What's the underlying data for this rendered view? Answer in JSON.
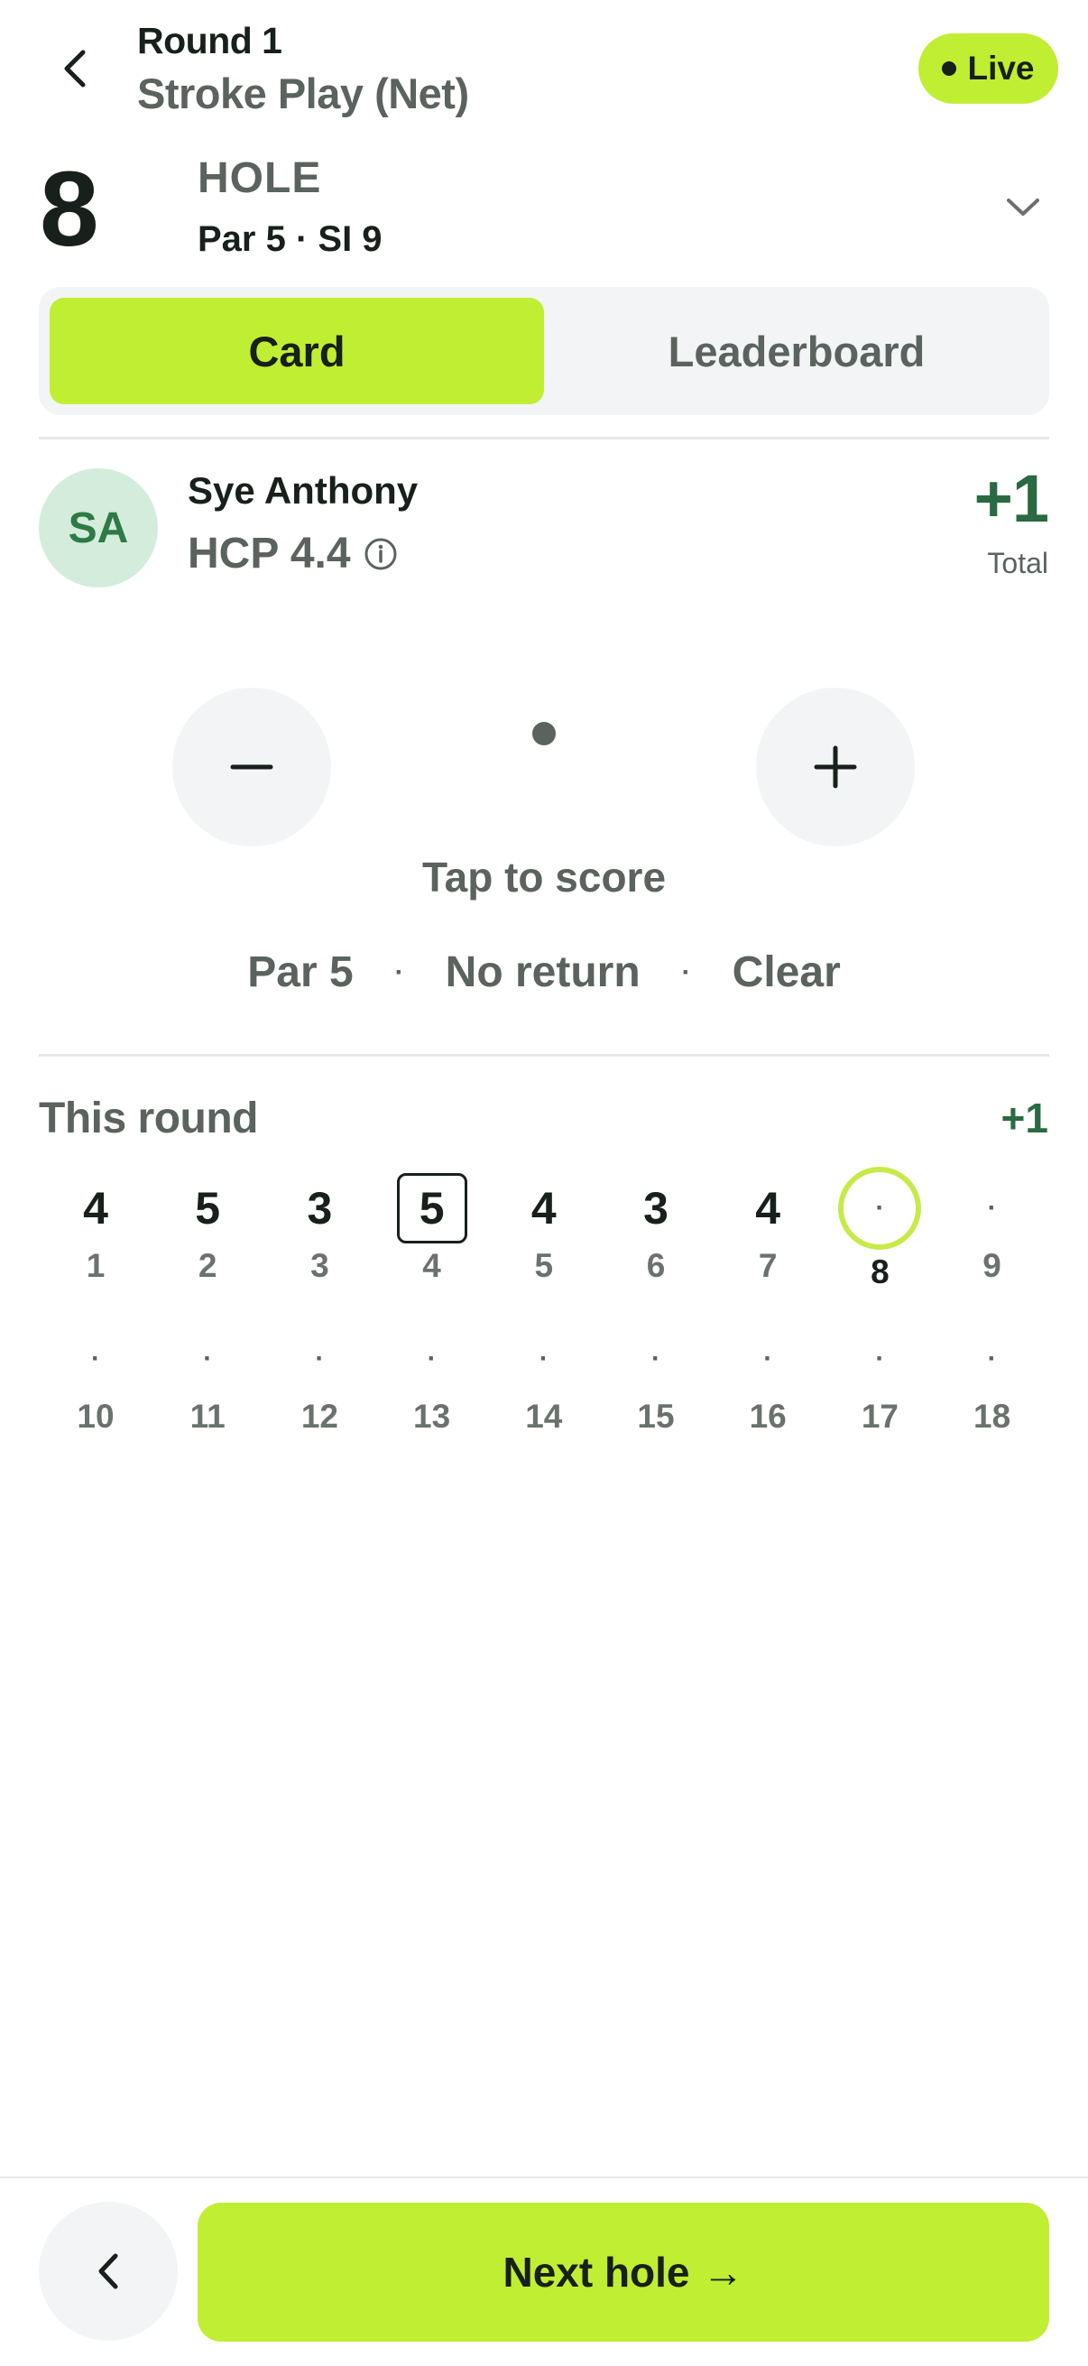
{
  "header": {
    "round_title": "Round 1",
    "format": "Stroke Play (Net)",
    "live_label": "Live"
  },
  "hole": {
    "number": "8",
    "label": "HOLE",
    "meta": "Par 5 · SI 9"
  },
  "tabs": [
    {
      "label": "Card",
      "selected": true
    },
    {
      "label": "Leaderboard",
      "selected": false
    }
  ],
  "player": {
    "initials": "SA",
    "name": "Sye Anthony",
    "hcp": "HCP 4.4",
    "total_score": "+1",
    "total_label": "Total"
  },
  "stepper": {
    "minus": "−",
    "plus": "+",
    "prompt": "Tap to score"
  },
  "quick_actions": {
    "par": "Par 5",
    "no_return": "No return",
    "clear": "Clear",
    "separator": "·"
  },
  "this_round": {
    "heading": "This round",
    "total": "+1",
    "empty_symbol": "·",
    "holes": [
      {
        "hole": "1",
        "score": "4",
        "state": "played"
      },
      {
        "hole": "2",
        "score": "5",
        "state": "played"
      },
      {
        "hole": "3",
        "score": "3",
        "state": "played"
      },
      {
        "hole": "4",
        "score": "5",
        "state": "bogey"
      },
      {
        "hole": "5",
        "score": "4",
        "state": "played"
      },
      {
        "hole": "6",
        "score": "3",
        "state": "played"
      },
      {
        "hole": "7",
        "score": "4",
        "state": "played"
      },
      {
        "hole": "8",
        "score": "·",
        "state": "current"
      },
      {
        "hole": "9",
        "score": "·",
        "state": "empty"
      },
      {
        "hole": "10",
        "score": "·",
        "state": "empty"
      },
      {
        "hole": "11",
        "score": "·",
        "state": "empty"
      },
      {
        "hole": "12",
        "score": "·",
        "state": "empty"
      },
      {
        "hole": "13",
        "score": "·",
        "state": "empty"
      },
      {
        "hole": "14",
        "score": "·",
        "state": "empty"
      },
      {
        "hole": "15",
        "score": "·",
        "state": "empty"
      },
      {
        "hole": "16",
        "score": "·",
        "state": "empty"
      },
      {
        "hole": "17",
        "score": "·",
        "state": "empty"
      },
      {
        "hole": "18",
        "score": "·",
        "state": "empty"
      }
    ]
  },
  "footer": {
    "next_label": "Next hole",
    "next_arrow": "→"
  },
  "colors": {
    "accent": "#c0ee33",
    "positive_green": "#2a6a42",
    "avatar_bg": "#d4ecdc",
    "muted_text": "#5a635e"
  }
}
